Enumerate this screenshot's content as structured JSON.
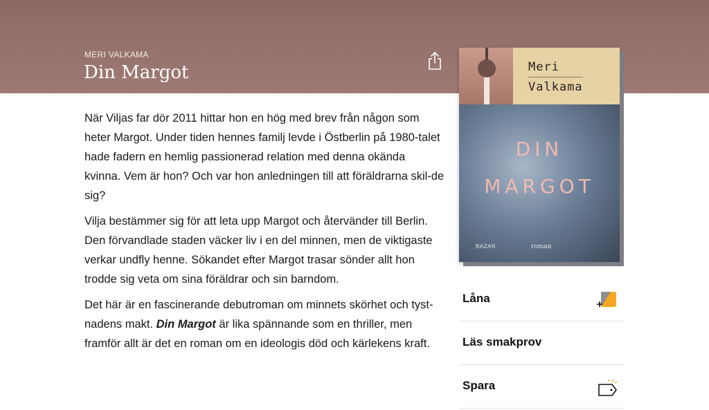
{
  "book": {
    "author": "MERI VALKAMA",
    "title": "Din Margot"
  },
  "description": {
    "p1": "När Viljas far dör 2011 hittar hon en hög med brev från någon som heter Margot. Under tiden hennes familj levde i Östberlin på 1980-talet hade fadern en hemlig passionerad relation med denna okända kvinna. Vem är hon? Och var hon anledningen till att föräldrarna skil-de sig?",
    "p2": "Vilja bestämmer sig för att leta upp Margot och återvänder till Berlin. Den förvandlade staden väcker liv i en del minnen, men de viktigaste verkar undfly henne. Sökandet efter Margot trasar sönder allt hon trodde sig veta om sina föräldrar och sin barndom.",
    "p3_before": "Det här är en fascinerande debutroman om minnets skörhet och tyst-nadens makt. ",
    "p3_emph": "Din Margot",
    "p3_after": " är lika spännande som en thriller, men framför allt är det en roman om en ideologis död och kärlekens kraft."
  },
  "cover": {
    "author_line1": "Meri",
    "author_line2": "Valkama",
    "title_line1": "DIN",
    "title_line2": "MARGOT",
    "publisher": "BAZAR",
    "genre": "roman"
  },
  "actions": [
    {
      "label": "Låna",
      "icon": "borrow-icon"
    },
    {
      "label": "Läs smakprov",
      "icon": ""
    },
    {
      "label": "Spara",
      "icon": "tag-save-icon"
    }
  ],
  "colors": {
    "header": "#9a7670",
    "accent_orange": "#f5a623",
    "cover_title": "#efb9b1"
  },
  "icons": {
    "share": "share-icon"
  }
}
